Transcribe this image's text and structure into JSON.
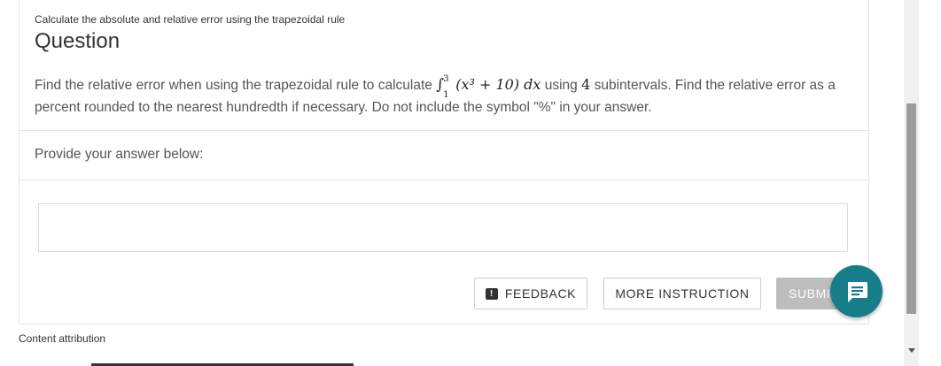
{
  "breadcrumb": "Calculate the absolute and relative error using the trapezoidal rule",
  "title": "Question",
  "question": {
    "before": "Find the relative error when using the trapezoidal rule to calculate",
    "integral_upper": "3",
    "integral_lower": "1",
    "integrand": "(x³ + 10) dx",
    "middle": "using",
    "subintervals": "4",
    "after": "subintervals. Find the relative error as a percent rounded to the nearest hundredth if necessary. Do not include the symbol \"%\" in your answer."
  },
  "prompt": "Provide your answer below:",
  "answer": {
    "value": "",
    "placeholder": ""
  },
  "buttons": {
    "feedback": "FEEDBACK",
    "more_instruction": "MORE INSTRUCTION",
    "submit": "SUBMIT"
  },
  "attribution": "Content attribution",
  "colors": {
    "chat_button": "#177e89",
    "submit_disabled": "#bdbdbd"
  },
  "icons": {
    "feedback": "feedback-exclamation-icon",
    "chat": "chat-message-icon"
  }
}
